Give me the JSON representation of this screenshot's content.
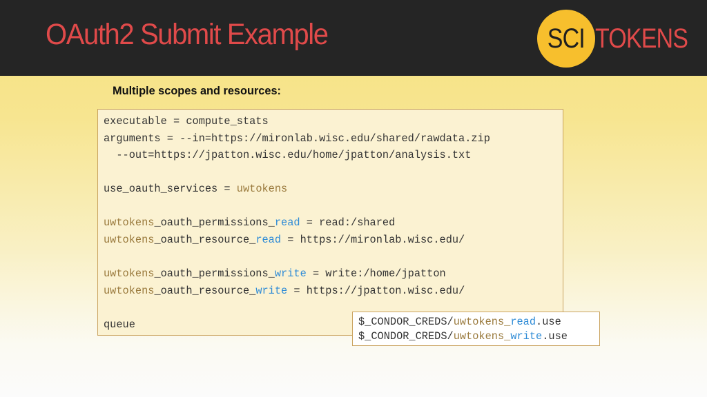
{
  "header": {
    "title": "OAuth2 Submit Example",
    "logo": {
      "left_text": "SCI",
      "right_text": "TOKENS"
    }
  },
  "subtitle": "Multiple scopes and resources:",
  "code": {
    "line1": "executable = compute_stats",
    "line2": "arguments = --in=https://mironlab.wisc.edu/shared/rawdata.zip",
    "line3": "  --out=https://jpatton.wisc.edu/home/jpatton/analysis.txt",
    "line4_prefix": "use_oauth_services = ",
    "service": "uwtokens",
    "perm_mid": "_oauth_permissions_",
    "res_mid": "_oauth_resource_",
    "read": "read",
    "write": "write",
    "read_perm_value": " = read:/shared",
    "read_res_value": " = https://mironlab.wisc.edu/",
    "write_perm_value": " = write:/home/jpatton",
    "write_res_value": " = https://jpatton.wisc.edu/",
    "queue": "queue"
  },
  "creds": {
    "prefix": "$_CONDOR_CREDS/",
    "service": "uwtokens",
    "sep": "_",
    "read": "read",
    "write": "write",
    "suffix": ".use"
  },
  "colors": {
    "title": "#e04a4a",
    "header_bg": "#252525",
    "logo_circle": "#f7bf2d",
    "keyword": "#9a7a3d",
    "scope": "#2e8bd6"
  }
}
